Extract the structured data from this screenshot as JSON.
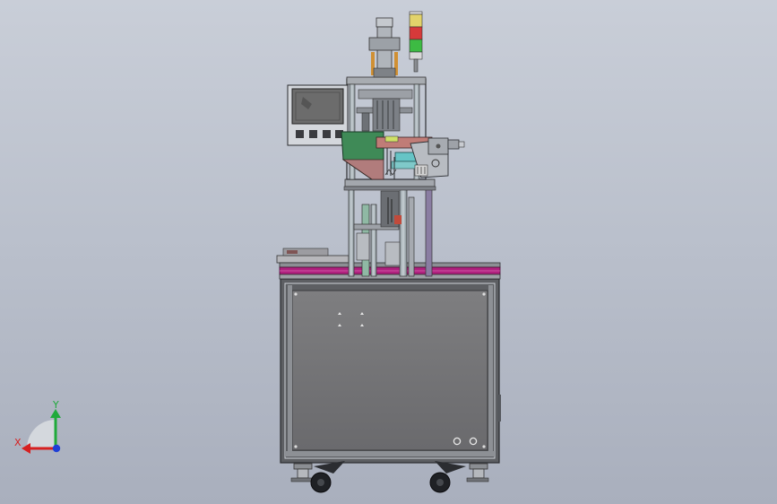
{
  "viewport": {
    "background_top": "#c9ced8",
    "background_bottom": "#a9afbd"
  },
  "model": {
    "frame_color": "#7a7d84",
    "accent_magenta": "#b0207e",
    "guard_green": "#3f8a57",
    "screen_color": "#6c6c6c",
    "signal_tower": [
      "yellow",
      "red",
      "green"
    ]
  },
  "triad": {
    "x_label": "X",
    "y_label": "Y",
    "x_color": "#d62020",
    "y_color": "#1faa3a",
    "z_color": "#1f3fd6"
  }
}
